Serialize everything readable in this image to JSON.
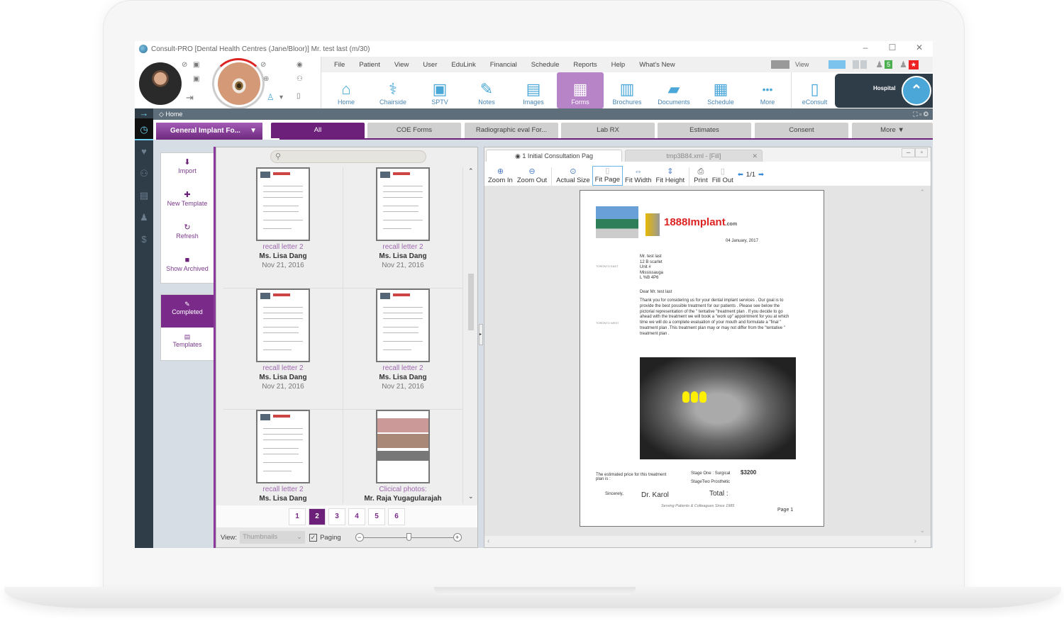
{
  "window": {
    "title": "Consult-PRO [Dental Health Centres (Jane/Bloor)]  Mr. test last (m/30)",
    "minimize": "–",
    "maximize": "☐",
    "close": "✕"
  },
  "menu": [
    "File",
    "Patient",
    "View",
    "User",
    "EduLink",
    "Financial",
    "Schedule",
    "Reports",
    "Help",
    "What's New"
  ],
  "menu_right": {
    "view_label": "View",
    "notification_count": "5"
  },
  "toolbar": [
    {
      "label": "Home",
      "icon": "⌂"
    },
    {
      "label": "Chairside",
      "icon": "⚕"
    },
    {
      "label": "SPTV",
      "icon": "▣"
    },
    {
      "label": "Notes",
      "icon": "✎"
    },
    {
      "label": "Images",
      "icon": "▤"
    },
    {
      "label": "Forms",
      "icon": "▦",
      "active": true
    },
    {
      "label": "Brochures",
      "icon": "▥"
    },
    {
      "label": "Documents",
      "icon": "▰"
    },
    {
      "label": "Schedule",
      "icon": "▦"
    },
    {
      "label": "More",
      "icon": "•••"
    },
    {
      "label": "eConsult",
      "icon": "▯"
    }
  ],
  "hospital": {
    "label": "Hospital",
    "logo": "⌃"
  },
  "breadcrumb": "Home",
  "template_select": "General Implant Fo...",
  "tabs": [
    "All",
    "COE Forms",
    "Radiographic  eval For...",
    "Lab RX",
    "Estimates",
    "Consent",
    "More ▼"
  ],
  "active_tab": "All",
  "actions": [
    {
      "label": "Import",
      "icon": "⬇"
    },
    {
      "label": "New Template",
      "icon": "✚"
    },
    {
      "label": "Refresh",
      "icon": "↻"
    },
    {
      "label": "Show Archived",
      "icon": "■"
    }
  ],
  "modes": [
    {
      "label": "Completed",
      "icon": "✎",
      "active": true
    },
    {
      "label": "Templates",
      "icon": "▤"
    }
  ],
  "search": {
    "placeholder": ""
  },
  "thumbnails": [
    {
      "title": "recall letter 2",
      "name": "Ms. Lisa Dang",
      "date": "Nov 21, 2016"
    },
    {
      "title": "recall letter 2",
      "name": "Ms. Lisa Dang",
      "date": "Nov 21, 2016"
    },
    {
      "title": "recall letter 2",
      "name": "Ms. Lisa Dang",
      "date": "Nov 21, 2016"
    },
    {
      "title": "recall letter 2",
      "name": "Ms. Lisa Dang",
      "date": "Nov 21, 2016"
    },
    {
      "title": "recall letter 2",
      "name": "Ms. Lisa Dang",
      "date": ""
    },
    {
      "title": "Clicical photos:",
      "name": "Mr. Raja Yugagularajah",
      "date": ""
    }
  ],
  "pagination": {
    "pages": [
      "1",
      "2",
      "3",
      "4",
      "5",
      "6"
    ],
    "current": "2"
  },
  "view_bar": {
    "label": "View:",
    "select": "Thumbnails",
    "paging_label": "Paging",
    "paging_checked": true,
    "zoom_level_fraction": 0.5
  },
  "viewer": {
    "tabs": [
      {
        "label": "1 Initial Consultation Pag",
        "active": true
      },
      {
        "label": "tmp3B84.xml - [Fill]",
        "active": false
      }
    ],
    "tools": [
      "Zoom In",
      "Zoom Out",
      "Actual Size",
      "Fit Page",
      "Fit Width",
      "Fit Height",
      "Print",
      "Fill Out"
    ],
    "active_tool": "Fit Page",
    "page_indicator": "1/1"
  },
  "document": {
    "brand": "1888Implant",
    "brand_suffix": ".com",
    "date": "04 January, 2017",
    "address": [
      "Mr. test last",
      "12 B scarlet",
      "Unit #",
      "Mississauga",
      "L %B 4P6"
    ],
    "salutation": "Dear    Mr. test last",
    "body": "Thank you for considering us for your dental implant services . Our goal is to provide the best possible  treatment for our patients . Please see below the pictorial representation of the \" tentative \"treatment plan . If you decide to go ahead with the treatment we will book a \"work up\" appointment  for you at which  time we will do a complete evaluation of your mouth and formulate a \"final \" treatment plan .This treatment plan may or may not differ from the \"tentative \" treatment plan .",
    "sidebar_toronto_east": "TORONTO EAST",
    "sidebar_toronto_west": "TORONTO WEST",
    "price_label": "The estimated price for this treatment plan is :",
    "stage_one": "Stage One : Surgical",
    "stage_two": "StageTwo  Prosthetic",
    "price": "$3200",
    "sincerely": "Sincerely,",
    "doctor": "Dr. Karol",
    "total": "Total :",
    "tagline": "Serving Patients & Colleagues Since 1985",
    "page": "Page 1"
  }
}
